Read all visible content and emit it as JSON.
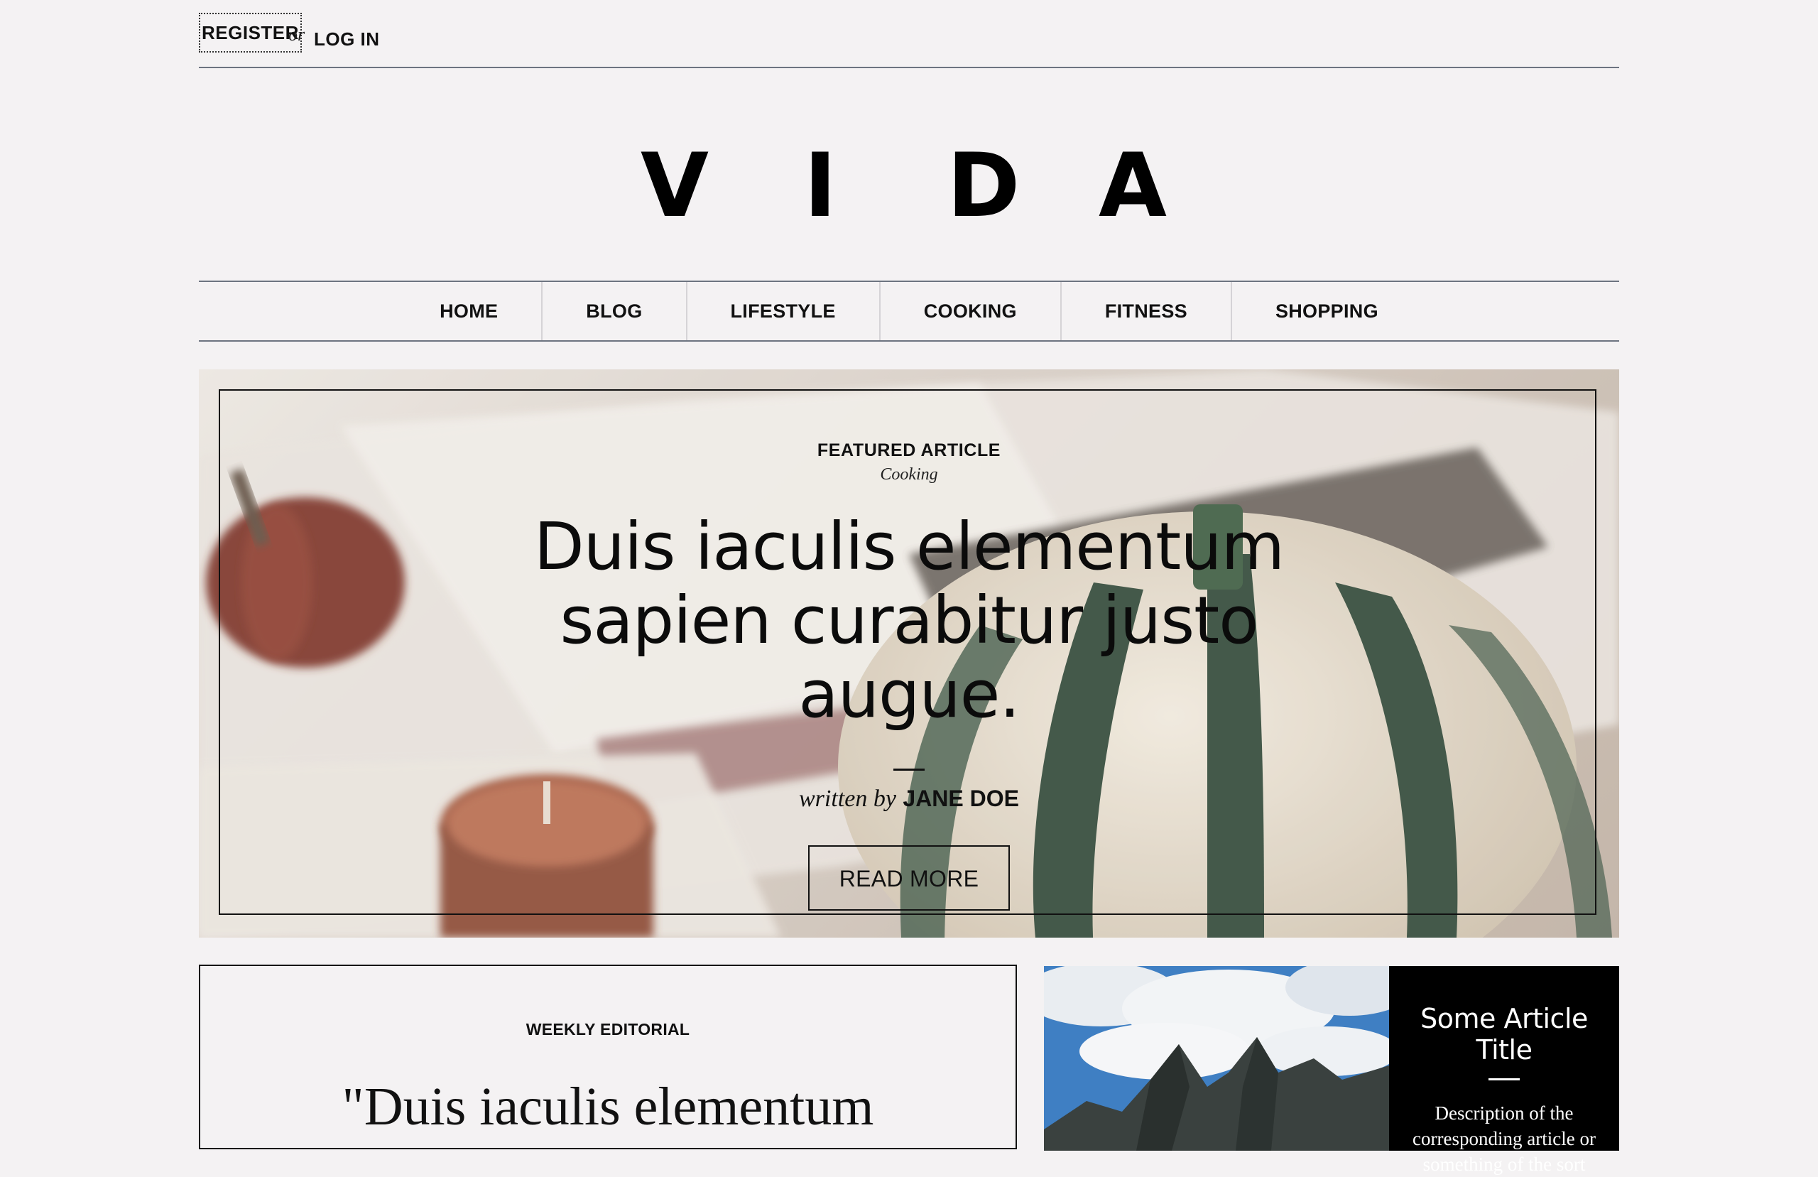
{
  "auth": {
    "register": "REGISTER",
    "or": "or",
    "login": "LOG IN"
  },
  "logo": {
    "letters": [
      "V",
      "I",
      "D",
      "A"
    ]
  },
  "nav": {
    "items": [
      "HOME",
      "BLOG",
      "LIFESTYLE",
      "COOKING",
      "FITNESS",
      "SHOPPING"
    ]
  },
  "hero": {
    "label": "FEATURED ARTICLE",
    "category": "Cooking",
    "title": "Duis iaculis elementum sapien curabitur justo augue.",
    "by": "written by",
    "author": "JANE DOE",
    "button": "READ MORE"
  },
  "editorial": {
    "label": "WEEKLY EDITORIAL",
    "quote": "\"Duis iaculis elementum"
  },
  "card": {
    "title": "Some Article Title",
    "description": "Description of the corresponding article or something of the sort"
  }
}
